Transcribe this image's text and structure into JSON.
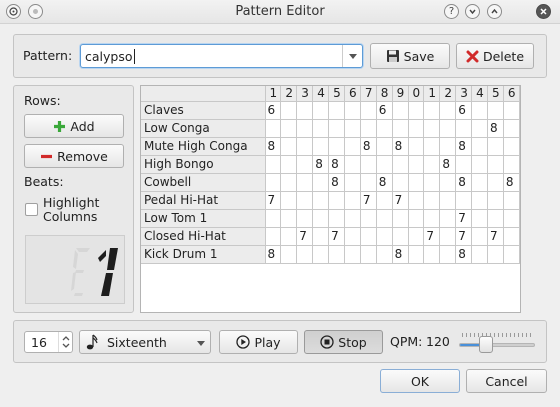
{
  "window": {
    "title": "Pattern Editor"
  },
  "pattern": {
    "label": "Pattern:",
    "value": "calypso",
    "save_label": "Save",
    "delete_label": "Delete"
  },
  "rows_panel": {
    "rows_label": "Rows:",
    "add_label": "Add",
    "remove_label": "Remove",
    "beats_label": "Beats:",
    "highlight_label_line1": "Highlight",
    "highlight_label_line2": "Columns",
    "highlight_checked": false,
    "lcd_value": "1"
  },
  "grid": {
    "columns": [
      "1",
      "2",
      "3",
      "4",
      "5",
      "6",
      "7",
      "8",
      "9",
      "0",
      "1",
      "2",
      "3",
      "4",
      "5",
      "6"
    ],
    "rows": [
      {
        "name": "Claves",
        "cells": [
          "6",
          "",
          "",
          "",
          "",
          "",
          "",
          "6",
          "",
          "",
          "",
          "",
          "6",
          "",
          "",
          ""
        ]
      },
      {
        "name": "Low Conga",
        "cells": [
          "",
          "",
          "",
          "",
          "",
          "",
          "",
          "",
          "",
          "",
          "",
          "",
          "",
          "",
          "8",
          ""
        ]
      },
      {
        "name": "Mute High Conga",
        "cells": [
          "8",
          "",
          "",
          "",
          "",
          "",
          "8",
          "",
          "8",
          "",
          "",
          "",
          "8",
          "",
          "",
          ""
        ]
      },
      {
        "name": "High Bongo",
        "cells": [
          "",
          "",
          "",
          "8",
          "8",
          "",
          "",
          "",
          "",
          "",
          "",
          "8",
          "",
          "",
          "",
          ""
        ]
      },
      {
        "name": "Cowbell",
        "cells": [
          "",
          "",
          "",
          "",
          "8",
          "",
          "",
          "8",
          "",
          "",
          "",
          "",
          "8",
          "",
          "",
          "8"
        ]
      },
      {
        "name": "Pedal Hi-Hat",
        "cells": [
          "7",
          "",
          "",
          "",
          "",
          "",
          "7",
          "",
          "7",
          "",
          "",
          "",
          "",
          "",
          "",
          ""
        ]
      },
      {
        "name": "Low Tom 1",
        "cells": [
          "",
          "",
          "",
          "",
          "",
          "",
          "",
          "",
          "",
          "",
          "",
          "",
          "7",
          "",
          "",
          ""
        ]
      },
      {
        "name": "Closed Hi-Hat",
        "cells": [
          "",
          "",
          "7",
          "",
          "7",
          "",
          "",
          "",
          "",
          "",
          "7",
          "",
          "7",
          "",
          "7",
          ""
        ]
      },
      {
        "name": "Kick Drum 1",
        "cells": [
          "8",
          "",
          "",
          "",
          "",
          "",
          "",
          "",
          "8",
          "",
          "",
          "",
          "8",
          "",
          "",
          ""
        ]
      }
    ]
  },
  "transport": {
    "count_value": "16",
    "note_value": "Sixteenth",
    "play_label": "Play",
    "stop_label": "Stop",
    "qpm_label": "QPM:",
    "qpm_value": "120",
    "qpm_level": 0.35
  },
  "dialog": {
    "ok_label": "OK",
    "cancel_label": "Cancel"
  },
  "colors": {
    "accent": "#4a90d9",
    "delete_red": "#d12a2a",
    "add_green": "#3aa83a"
  }
}
